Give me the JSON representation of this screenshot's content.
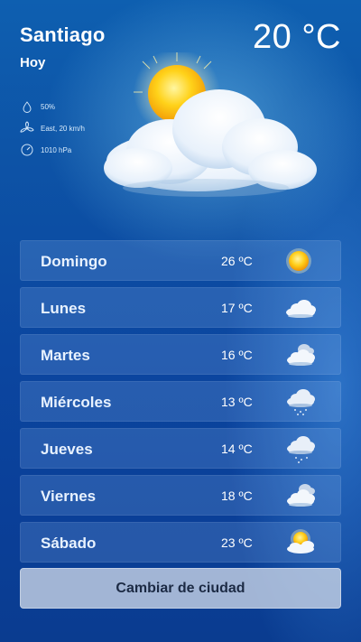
{
  "header": {
    "city": "Santiago",
    "day_label": "Hoy",
    "temperature": "20 °C"
  },
  "conditions": {
    "humidity": "50%",
    "wind": "East, 20 km/h",
    "pressure": "1010 hPa",
    "current_icon": "sun-behind-cloud-icon"
  },
  "forecast": [
    {
      "day": "Domingo",
      "temp": "26 ºC",
      "icon": "sun-icon"
    },
    {
      "day": "Lunes",
      "temp": "17 ºC",
      "icon": "cloud-icon"
    },
    {
      "day": "Martes",
      "temp": "16 ºC",
      "icon": "cloudy-icon"
    },
    {
      "day": "Miércoles",
      "temp": "13 ºC",
      "icon": "rain-cloud-icon"
    },
    {
      "day": "Jueves",
      "temp": "14 ºC",
      "icon": "rain-cloud-icon"
    },
    {
      "day": "Viernes",
      "temp": "18 ºC",
      "icon": "cloudy-icon"
    },
    {
      "day": "Sábado",
      "temp": "23 ºC",
      "icon": "sun-behind-cloud-icon"
    }
  ],
  "actions": {
    "change_city": "Cambiar de ciudad"
  }
}
